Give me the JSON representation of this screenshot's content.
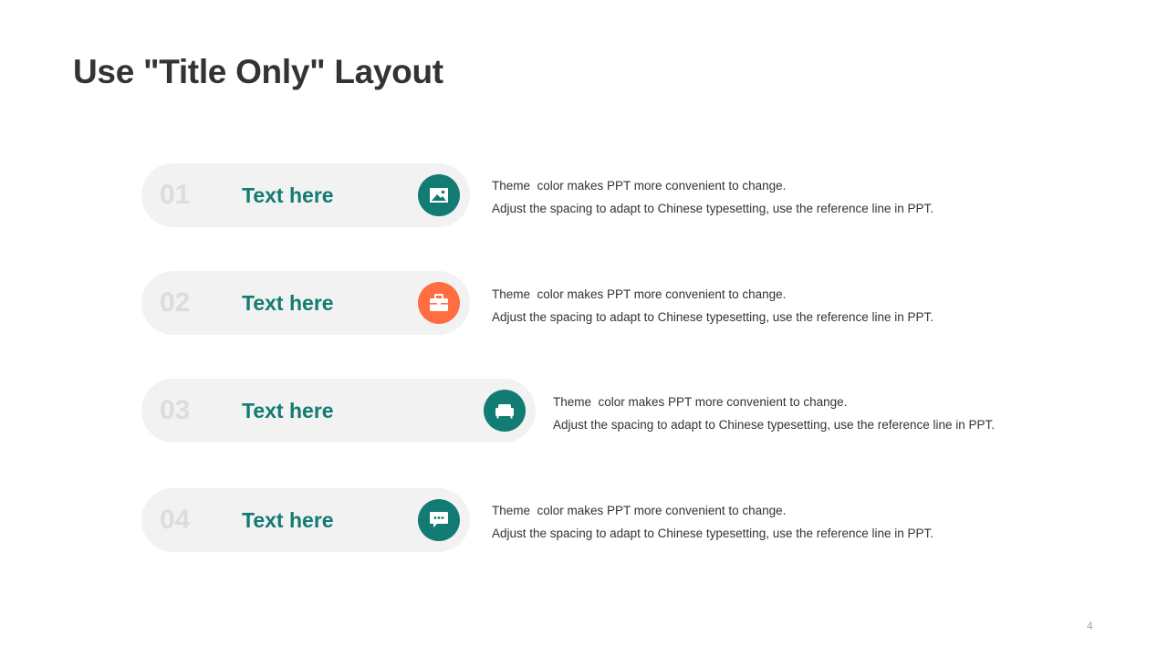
{
  "title": "Use \"Title Only\" Layout",
  "colors": {
    "teal": "#127b73",
    "orange": "#ff6e40",
    "pill_background": "#f2f2f2",
    "number": "#dcdcdc"
  },
  "items": [
    {
      "number": "01",
      "heading": "Text here",
      "icon": "image-icon",
      "icon_color": "#127b73",
      "desc_line1": "Theme  color makes PPT more convenient to change.",
      "desc_line2": "Adjust the spacing to adapt to Chinese typesetting, use the reference line in PPT."
    },
    {
      "number": "02",
      "heading": "Text here",
      "icon": "briefcase-icon",
      "icon_color": "#ff6e40",
      "desc_line1": "Theme  color makes PPT more convenient to change.",
      "desc_line2": "Adjust the spacing to adapt to Chinese typesetting, use the reference line in PPT."
    },
    {
      "number": "03",
      "heading": "Text here",
      "icon": "sofa-icon",
      "icon_color": "#127b73",
      "desc_line1": "Theme  color makes PPT more convenient to change.",
      "desc_line2": "Adjust the spacing to adapt to Chinese typesetting, use the reference line in PPT."
    },
    {
      "number": "04",
      "heading": "Text here",
      "icon": "chat-bubble-icon",
      "icon_color": "#127b73",
      "desc_line1": "Theme  color makes PPT more convenient to change.",
      "desc_line2": "Adjust the spacing to adapt to Chinese typesetting, use the reference line in PPT."
    }
  ],
  "page_number": "4"
}
